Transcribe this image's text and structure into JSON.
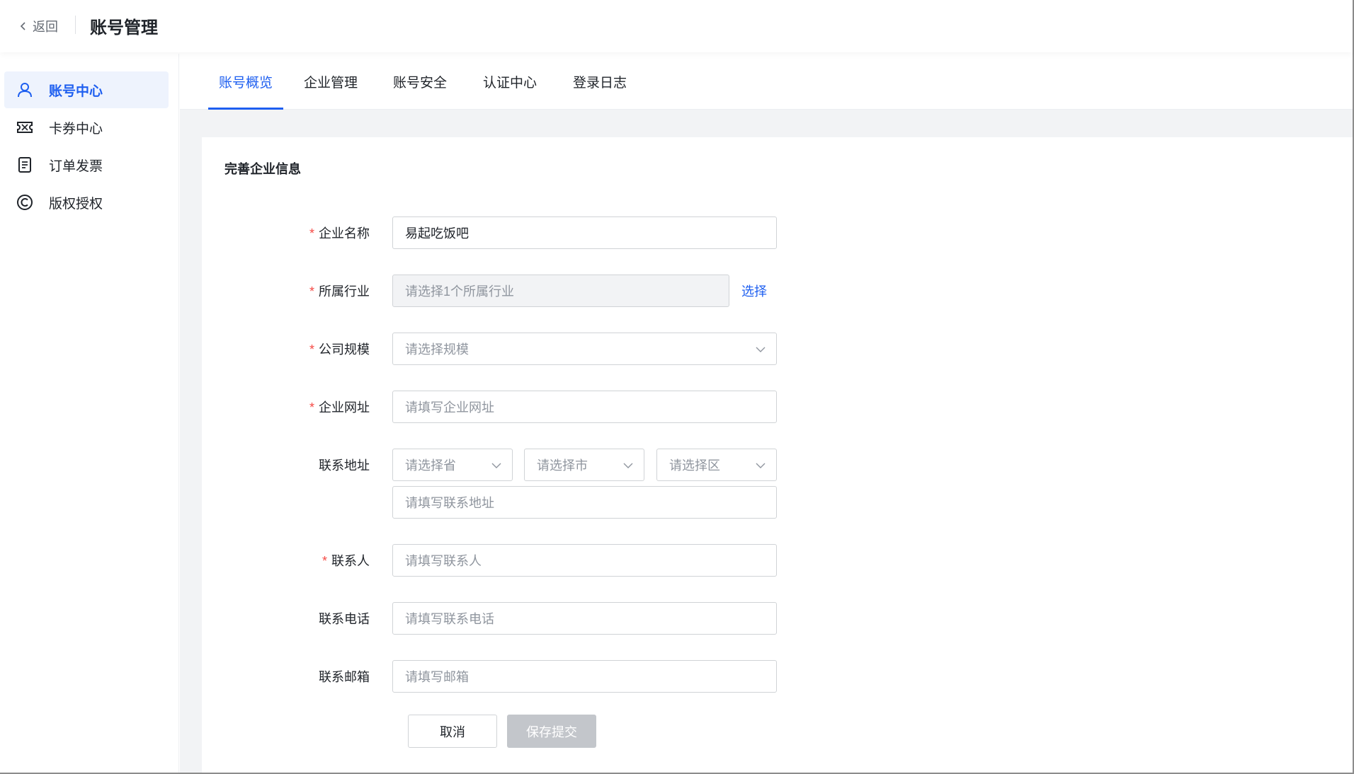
{
  "header": {
    "back_label": "返回",
    "title": "账号管理"
  },
  "sidebar": {
    "items": [
      {
        "label": "账号中心",
        "icon": "user-icon",
        "active": true
      },
      {
        "label": "卡券中心",
        "icon": "coupon-icon",
        "active": false
      },
      {
        "label": "订单发票",
        "icon": "invoice-icon",
        "active": false
      },
      {
        "label": "版权授权",
        "icon": "copyright-icon",
        "active": false
      }
    ]
  },
  "tabs": [
    {
      "label": "账号概览",
      "active": true
    },
    {
      "label": "企业管理",
      "active": false
    },
    {
      "label": "账号安全",
      "active": false
    },
    {
      "label": "认证中心",
      "active": false
    },
    {
      "label": "登录日志",
      "active": false
    }
  ],
  "form": {
    "title": "完善企业信息",
    "required_mark": "*",
    "company_name": {
      "label": "企业名称",
      "value": "易起吃饭吧",
      "required": true
    },
    "industry": {
      "label": "所属行业",
      "placeholder": "请选择1个所属行业",
      "required": true,
      "action_label": "选择"
    },
    "scale": {
      "label": "公司规模",
      "placeholder": "请选择规模",
      "required": true
    },
    "website": {
      "label": "企业网址",
      "placeholder": "请填写企业网址",
      "required": true
    },
    "address": {
      "label": "联系地址",
      "province_placeholder": "请选择省",
      "city_placeholder": "请选择市",
      "district_placeholder": "请选择区",
      "detail_placeholder": "请填写联系地址"
    },
    "contact": {
      "label": "联系人",
      "placeholder": "请填写联系人",
      "required": true
    },
    "phone": {
      "label": "联系电话",
      "placeholder": "请填写联系电话"
    },
    "email": {
      "label": "联系邮箱",
      "placeholder": "请填写邮箱"
    },
    "buttons": {
      "cancel": "取消",
      "submit": "保存提交"
    }
  },
  "colors": {
    "primary": "#1e5ff0",
    "required": "#f54a45",
    "active_bg": "#eef3fd",
    "content_bg": "#f2f3f5"
  }
}
